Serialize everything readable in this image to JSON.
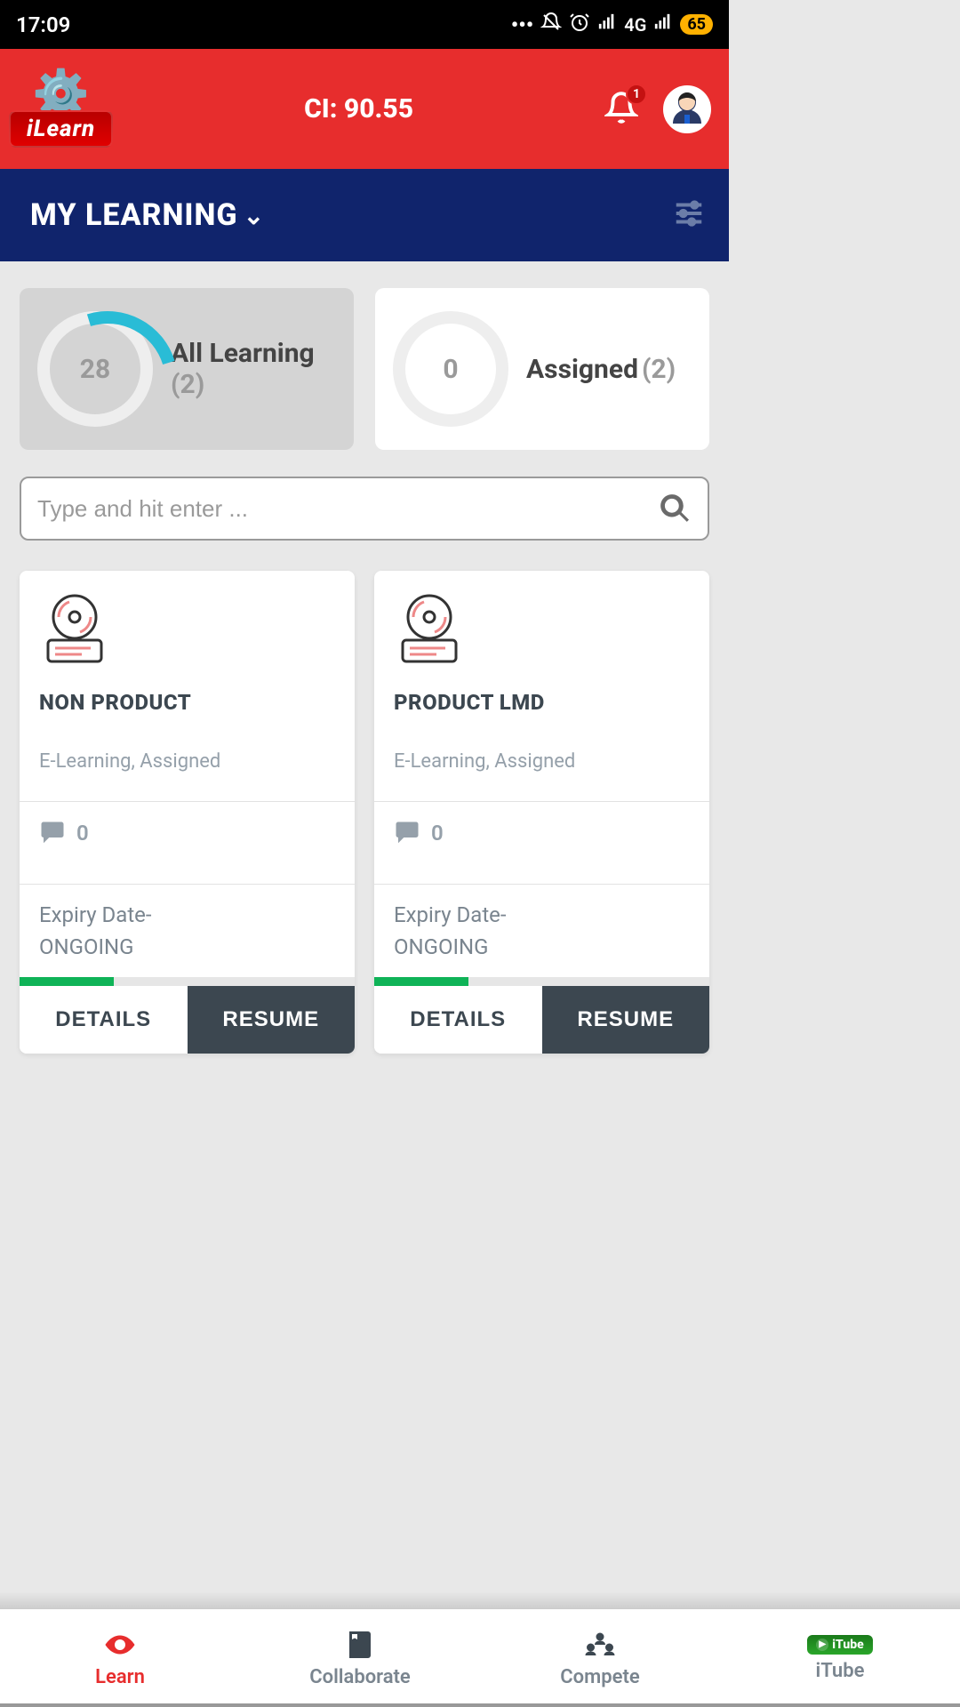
{
  "status": {
    "time": "17:09",
    "network": "4G",
    "battery": "65"
  },
  "header": {
    "ci_label": "CI: 90.55",
    "notifications": "1",
    "logo_text": "iLearn"
  },
  "nav": {
    "title": "MY LEARNING"
  },
  "categories": [
    {
      "value": "28",
      "label": "All Learning",
      "count": "(2)"
    },
    {
      "value": "0",
      "label": "Assigned",
      "count": "(2)"
    }
  ],
  "search": {
    "placeholder": "Type and hit enter ..."
  },
  "courses": [
    {
      "title": "NON PRODUCT",
      "meta": "E-Learning, Assigned",
      "comments": "0",
      "expiry_label": "Expiry Date-",
      "expiry_status": "ONGOING",
      "progress_pct": 28,
      "details_label": "DETAILS",
      "resume_label": "RESUME"
    },
    {
      "title": "PRODUCT LMD",
      "meta": "E-Learning, Assigned",
      "comments": "0",
      "expiry_label": "Expiry Date-",
      "expiry_status": "ONGOING",
      "progress_pct": 28,
      "details_label": "DETAILS",
      "resume_label": "RESUME"
    }
  ],
  "bottom": {
    "learn": "Learn",
    "collaborate": "Collaborate",
    "compete": "Compete",
    "itube": "iTube",
    "itube_pill": "iTube"
  }
}
